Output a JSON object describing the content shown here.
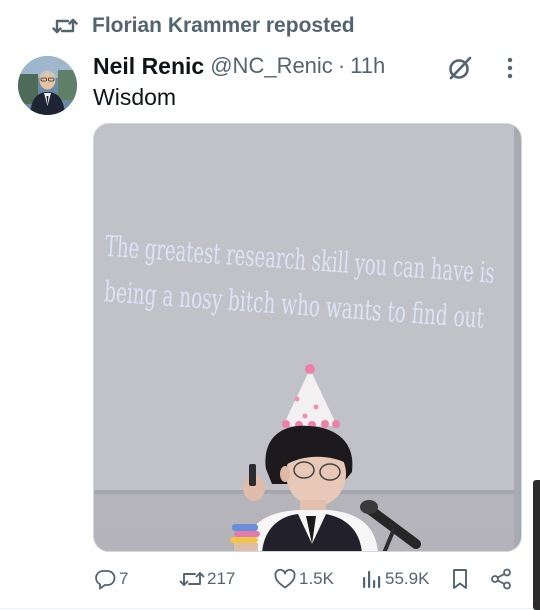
{
  "repost": {
    "icon": "repost-icon",
    "text": "Florian Krammer reposted"
  },
  "author": {
    "display_name": "Neil Renic",
    "handle": "@NC_Renic",
    "separator": "·",
    "time": "11h",
    "avatar_icon": "avatar"
  },
  "tweet": {
    "text": "Wisdom",
    "media": {
      "slide_line_1": "The greatest research skill you can have is",
      "slide_line_2": "being a nosy bitch who wants to find out"
    }
  },
  "header_icons": {
    "grok": "grok-icon",
    "more": "more-options-icon"
  },
  "actions": {
    "replies": "7",
    "reposts": "217",
    "likes": "1.5K",
    "views": "55.9K"
  },
  "colors": {
    "text_primary": "#0f1419",
    "text_secondary": "#536471",
    "slide_text": "#dde3f6",
    "slide_bg": "#b9b9c0"
  }
}
